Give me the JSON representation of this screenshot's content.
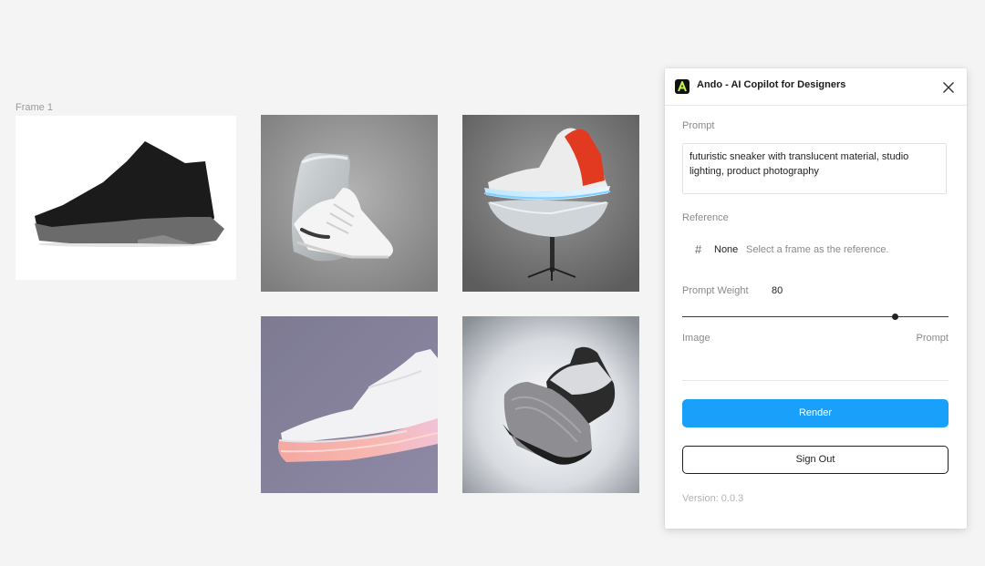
{
  "canvas": {
    "frame_label": "Frame 1",
    "images": [
      {
        "name": "sneaker-in-glass-render"
      },
      {
        "name": "sneaker-red-on-stand-render"
      },
      {
        "name": "sneaker-glowing-sole-render"
      },
      {
        "name": "sneaker-pair-knit-render"
      }
    ]
  },
  "panel": {
    "title": "Ando - AI Copilot for Designers",
    "logo_icon": "ando-logo-icon",
    "close_icon": "close-icon",
    "prompt_label": "Prompt",
    "prompt_value": "futuristic sneaker with translucent material, studio lighting, product photography",
    "reference_label": "Reference",
    "reference_icon": "frame-hash-icon",
    "reference_value": "None",
    "reference_hint": "Select a frame as the reference.",
    "weight_label": "Prompt Weight",
    "weight_value": "80",
    "slider": {
      "min": 0,
      "max": 100,
      "value": 80
    },
    "slider_left_label": "Image",
    "slider_right_label": "Prompt",
    "render_label": "Render",
    "signout_label": "Sign Out",
    "version": "Version: 0.0.3",
    "accent_color": "#18a0fb",
    "logo_color": "#c6f24e"
  }
}
